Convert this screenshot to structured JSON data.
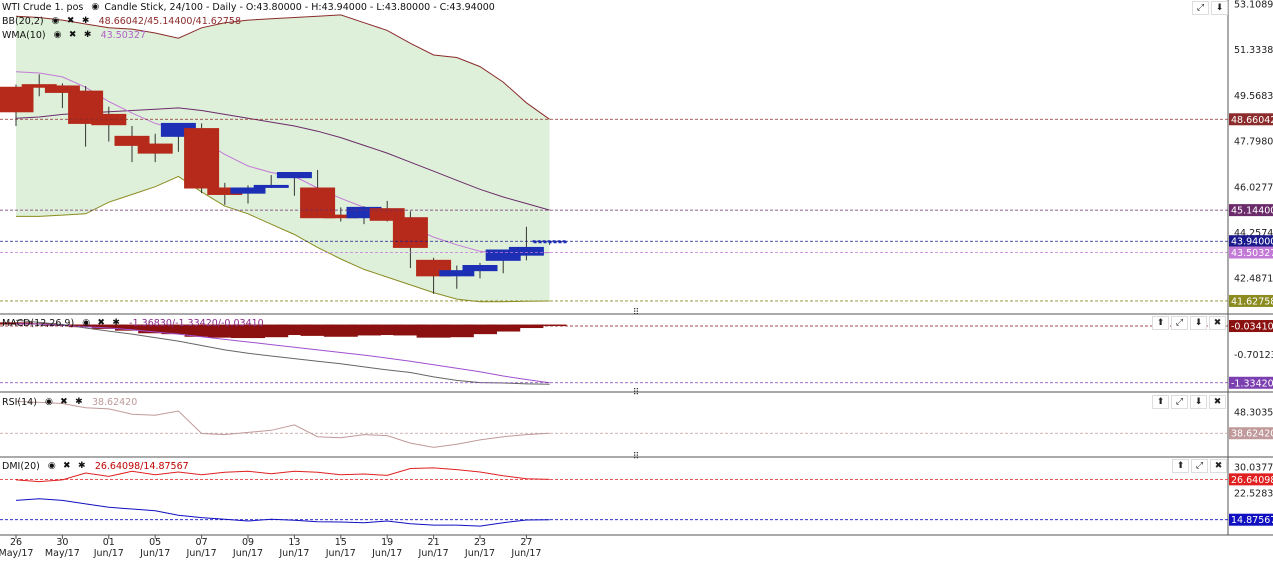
{
  "main": {
    "symbol": "WTI Crude 1. pos",
    "chart_type": "Candle Stick, 24/100 - Daily - O:43.80000 - H:43.94000 - L:43.80000 - C:43.94000",
    "bb_label": "BB(20,2)",
    "bb_values": "48.66042/45.14400/41.62758",
    "wma_label": "WMA(10)",
    "wma_value": "43.50327"
  },
  "macd": {
    "label": "MACD(12,26,9)",
    "values": "-1.36830/-1.33420/-0.03410"
  },
  "rsi": {
    "label": "RSI(14)",
    "value": "38.62420"
  },
  "dmi": {
    "label": "DMI(20)",
    "values": "26.64098/14.87567"
  },
  "axes": {
    "main_ticks": [
      "53.10890",
      "51.33384",
      "49.56830",
      "47.79801",
      "46.02771",
      "44.25741",
      "42.48712"
    ],
    "main_tags": [
      "48.66042",
      "45.14400",
      "43.94000",
      "43.50327",
      "41.62758"
    ],
    "macd_ticks": [
      "-0.70123"
    ],
    "macd_tags": [
      "-0.03410",
      "-1.33420"
    ],
    "rsi_ticks": [
      "48.30354"
    ],
    "rsi_tags": [
      "38.62420"
    ],
    "dmi_ticks": [
      "30.03778",
      "22.52834"
    ],
    "dmi_tags": [
      "26.64098",
      "14.87567"
    ],
    "x_days": [
      "26",
      "30",
      "01",
      "05",
      "07",
      "09",
      "13",
      "15",
      "19",
      "21",
      "23",
      "27"
    ],
    "x_months": [
      "May/17",
      "May/17",
      "Jun/17",
      "Jun/17",
      "Jun/17",
      "Jun/17",
      "Jun/17",
      "Jun/17",
      "Jun/17",
      "Jun/17",
      "Jun/17",
      "Jun/17"
    ]
  },
  "colors": {
    "up": "#1d2fb5",
    "down": "#b52a1a",
    "bb_upper": "#8b2b2b",
    "bb_mid": "#6b2b6b",
    "bb_lower": "#8b8b20",
    "bb_fill": "#dff0da",
    "wma": "#c27ad6",
    "price_tag": "#1a1a8c",
    "dmi_plus": "#e02020",
    "dmi_minus": "#1010c0",
    "rsi_line": "#c09a9a",
    "macd_hist": "#8b1010"
  },
  "icons": {
    "eye": "eye-icon",
    "close": "close-icon",
    "gear": "gear-icon",
    "up": "move-up-icon",
    "expand": "expand-icon",
    "down": "move-down-icon"
  },
  "chart_data": [
    {
      "type": "candlestick",
      "x": [
        "May 26",
        "May 29",
        "May 30",
        "May 31",
        "Jun 01",
        "Jun 02",
        "Jun 05",
        "Jun 06",
        "Jun 07",
        "Jun 08",
        "Jun 09",
        "Jun 12",
        "Jun 13",
        "Jun 14",
        "Jun 15",
        "Jun 16",
        "Jun 19",
        "Jun 20",
        "Jun 21",
        "Jun 22",
        "Jun 23",
        "Jun 26",
        "Jun 27",
        "Jun 28"
      ],
      "open": [
        49.9,
        50.0,
        49.95,
        49.75,
        48.85,
        48.0,
        47.7,
        48.0,
        48.3,
        46.0,
        45.8,
        46.1,
        46.4,
        46.0,
        44.95,
        44.85,
        45.2,
        44.85,
        43.2,
        42.6,
        42.8,
        43.2,
        43.4,
        43.8
      ],
      "high": [
        50.0,
        50.4,
        50.05,
        49.95,
        49.15,
        48.4,
        48.1,
        48.5,
        48.5,
        46.2,
        46.1,
        46.5,
        46.6,
        46.7,
        45.25,
        45.3,
        45.5,
        45.1,
        43.3,
        43.0,
        43.1,
        43.6,
        44.5,
        43.94
      ],
      "low": [
        48.4,
        49.55,
        49.1,
        47.6,
        47.8,
        47.0,
        47.0,
        47.4,
        45.8,
        45.35,
        45.4,
        46.0,
        45.7,
        44.9,
        44.7,
        44.6,
        44.7,
        42.9,
        41.9,
        42.1,
        42.5,
        42.7,
        43.2,
        43.8
      ],
      "close": [
        48.95,
        49.9,
        49.7,
        48.5,
        48.45,
        47.65,
        47.35,
        48.5,
        46.0,
        45.75,
        46.0,
        46.1,
        46.6,
        44.85,
        44.85,
        45.25,
        44.75,
        43.7,
        42.6,
        42.8,
        43.0,
        43.6,
        43.7,
        43.94
      ],
      "series": [
        {
          "name": "BB(20,2)",
          "values": [
            null,
            null,
            null,
            null,
            null,
            null,
            null,
            null,
            null,
            null,
            null,
            null,
            null,
            null,
            null,
            null,
            null,
            null,
            null,
            null,
            null,
            null,
            null,
            null
          ]
        }
      ],
      "bb_upper": [
        52.65,
        52.6,
        52.5,
        52.35,
        52.2,
        52.15,
        52.0,
        51.8,
        52.2,
        52.4,
        52.5,
        52.55,
        52.6,
        52.65,
        52.7,
        52.4,
        52.1,
        51.6,
        51.15,
        51.05,
        50.7,
        50.1,
        49.3,
        48.66
      ],
      "bb_mid": [
        48.7,
        48.75,
        48.85,
        48.9,
        48.95,
        49.0,
        49.05,
        49.1,
        49.0,
        48.85,
        48.7,
        48.55,
        48.4,
        48.2,
        47.95,
        47.65,
        47.35,
        47.0,
        46.65,
        46.3,
        45.95,
        45.65,
        45.4,
        45.144
      ],
      "bb_lower": [
        44.9,
        44.9,
        44.95,
        45.0,
        45.45,
        45.75,
        46.05,
        46.45,
        45.85,
        45.3,
        45.0,
        44.6,
        44.2,
        43.7,
        43.25,
        42.85,
        42.55,
        42.25,
        41.95,
        41.7,
        41.6,
        41.6,
        41.62,
        41.62758
      ],
      "wma": [
        50.5,
        50.45,
        50.3,
        49.9,
        49.35,
        48.9,
        48.5,
        48.25,
        47.85,
        47.3,
        46.85,
        46.6,
        46.45,
        46.0,
        45.6,
        45.25,
        44.95,
        44.5,
        44.1,
        43.8,
        43.55,
        43.45,
        43.45,
        43.50327
      ],
      "ylim": [
        41.2,
        53.2
      ]
    },
    {
      "type": "bar",
      "title": "MACD(12,26,9)",
      "values": [
        0.05,
        0.03,
        0.0,
        -0.06,
        -0.1,
        -0.14,
        -0.2,
        -0.22,
        -0.28,
        -0.3,
        -0.31,
        -0.29,
        -0.24,
        -0.26,
        -0.28,
        -0.25,
        -0.24,
        -0.25,
        -0.3,
        -0.29,
        -0.22,
        -0.16,
        -0.08,
        -0.0341
      ],
      "macd": [
        0.1,
        0.05,
        0.0,
        -0.08,
        -0.15,
        -0.22,
        -0.3,
        -0.38,
        -0.48,
        -0.58,
        -0.66,
        -0.72,
        -0.78,
        -0.84,
        -0.9,
        -0.97,
        -1.04,
        -1.1,
        -1.2,
        -1.28,
        -1.33,
        -1.34,
        -1.36,
        -1.3683
      ],
      "signal": [
        0.02,
        0.01,
        -0.02,
        -0.05,
        -0.08,
        -0.12,
        -0.17,
        -0.22,
        -0.28,
        -0.34,
        -0.4,
        -0.46,
        -0.52,
        -0.58,
        -0.64,
        -0.7,
        -0.77,
        -0.84,
        -0.92,
        -1.0,
        -1.08,
        -1.18,
        -1.26,
        -1.3342
      ],
      "ylim": [
        -1.5,
        0.15
      ]
    },
    {
      "type": "line",
      "title": "RSI(14)",
      "values": [
        53.5,
        53.0,
        52.5,
        50.5,
        50.0,
        47.5,
        47.0,
        49.0,
        38.5,
        38.0,
        39.0,
        40.0,
        42.5,
        37.0,
        36.5,
        38.0,
        37.5,
        34.0,
        32.0,
        33.5,
        35.5,
        37.0,
        38.0,
        38.6242
      ],
      "ylim": [
        28,
        56
      ]
    },
    {
      "type": "line",
      "title": "DMI(20)",
      "series": [
        {
          "name": "+DI",
          "values": [
            26.5,
            26.0,
            26.5,
            28.5,
            27.5,
            29.0,
            28.0,
            28.8,
            28.0,
            28.7,
            29.0,
            28.3,
            29.0,
            28.7,
            28.0,
            28.2,
            27.8,
            29.8,
            30.0,
            29.5,
            28.8,
            27.7,
            26.8,
            26.64098
          ]
        },
        {
          "name": "-DI",
          "values": [
            20.5,
            21.0,
            20.5,
            19.5,
            18.5,
            18.0,
            17.5,
            16.2,
            15.5,
            15.0,
            14.5,
            15.0,
            14.7,
            14.3,
            14.2,
            14.0,
            14.5,
            13.7,
            13.3,
            13.3,
            13.0,
            14.0,
            14.8,
            14.87567
          ]
        }
      ],
      "ylim": [
        11,
        32
      ]
    }
  ]
}
